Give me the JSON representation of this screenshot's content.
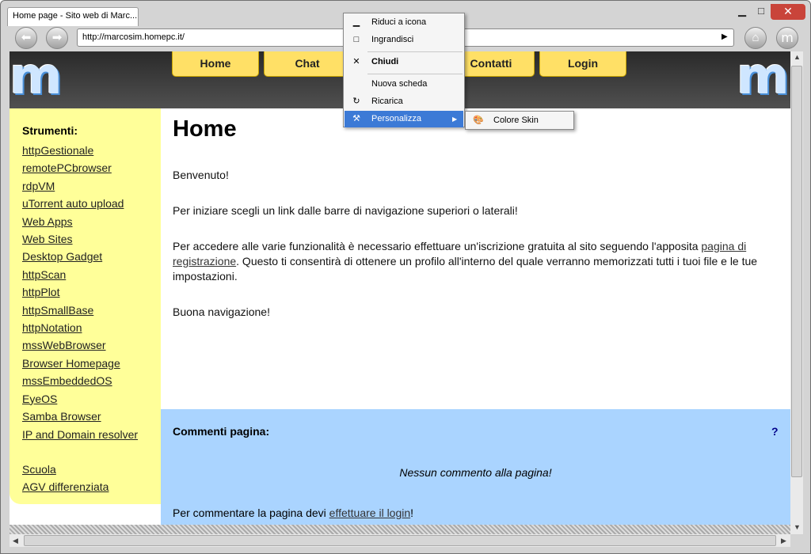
{
  "browser": {
    "tab_title": "Home page - Sito web di Marc...",
    "address": "http://marcosim.homepc.it/",
    "min_icon": "minimize-icon",
    "max_icon": "maximize-icon",
    "close_icon": "close-icon"
  },
  "site": {
    "logo_letter": "m",
    "nav": [
      "Home",
      "Chat",
      "Contatti",
      "Login"
    ],
    "sidebar_title": "Strumenti:",
    "sidebar_links": [
      "httpGestionale",
      "remotePCbrowser",
      "rdpVM",
      "uTorrent auto upload",
      "Web Apps",
      "Web Sites",
      "Desktop Gadget",
      "httpScan",
      "httpPlot",
      "httpSmallBase",
      "httpNotation",
      "mssWebBrowser",
      "Browser Homepage",
      "mssEmbeddedOS",
      "EyeOS",
      "Samba Browser",
      "IP and Domain resolver"
    ],
    "sidebar_links2": [
      "Scuola",
      "AGV differenziata"
    ],
    "page_title": "Home",
    "welcome": "Benvenuto!",
    "intro": "Per iniziare scegli un link dalle barre di navigazione superiori o laterali!",
    "register_before": "Per accedere alle varie funzionalità è necessario effettuare un'iscrizione gratuita al sito seguendo l'apposita ",
    "register_link": "pagina di registrazione",
    "register_after": ". Questo ti consentirà di ottenere un profilo all'interno del quale verranno memorizzati tutti i tuoi file e le tue impostazioni.",
    "goodbye": "Buona navigazione!",
    "comments_title": "Commenti pagina:",
    "help": "?",
    "no_comments": "Nessun commento alla pagina!",
    "login_before": "Per commentare la pagina devi ",
    "login_link": "effettuare il login",
    "login_after": "!"
  },
  "context_menu": {
    "items": [
      "Riduci a icona",
      "Ingrandisci",
      "Chiudi",
      "Nuova scheda",
      "Ricarica",
      "Personalizza"
    ],
    "submenu_item": "Colore Skin"
  },
  "colors": {
    "accent_yellow": "#ffe066",
    "sidebar": "#ffff99",
    "comments": "#aad4ff",
    "menu_highlight": "#3c7ad6",
    "close_button": "#c9443a"
  }
}
